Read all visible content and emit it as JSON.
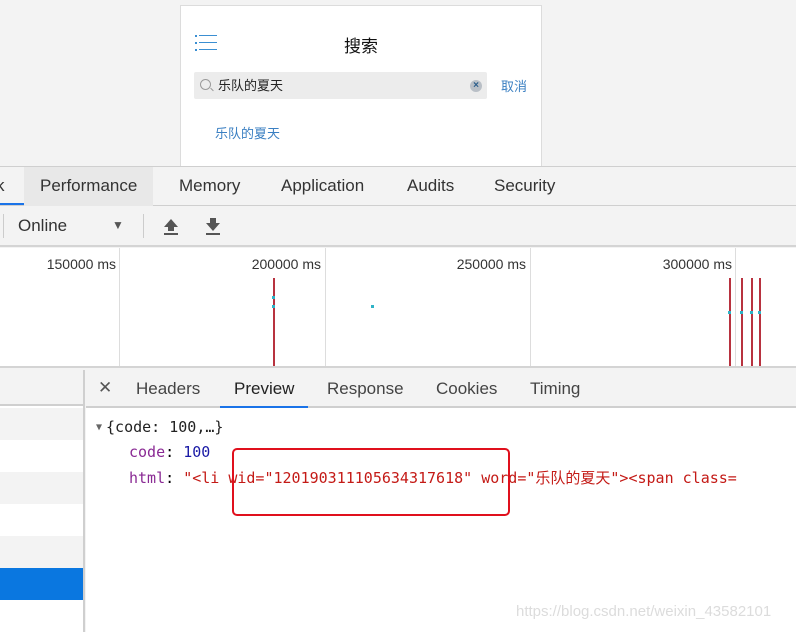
{
  "page": {
    "title": "搜索",
    "search": {
      "value": "乐队的夏天",
      "placeholder": ""
    },
    "cancel_label": "取消",
    "suggestion": "乐队的夏天"
  },
  "devtools": {
    "tabs": [
      {
        "label": "k"
      },
      {
        "label": "Performance",
        "active": true
      },
      {
        "label": "Memory"
      },
      {
        "label": "Application"
      },
      {
        "label": "Audits"
      },
      {
        "label": "Security"
      }
    ],
    "toolbar": {
      "throttle": "Online",
      "upload_icon": "import-icon",
      "download_icon": "export-icon"
    },
    "timeline": {
      "ticks": [
        "150000 ms",
        "200000 ms",
        "250000 ms",
        "300000 ms"
      ]
    },
    "detail": {
      "close_icon": "close-icon",
      "tabs": [
        {
          "label": "Headers"
        },
        {
          "label": "Preview",
          "active": true
        },
        {
          "label": "Response"
        },
        {
          "label": "Cookies"
        },
        {
          "label": "Timing"
        }
      ],
      "preview": {
        "root_summary": "{code: 100,…}",
        "code_key": "code",
        "code_value": "100",
        "html_key": "html",
        "html_prefix": "\"<li ",
        "html_wid": "wid=\"120190311105634317618\"",
        "html_rest": " word=\"乐队的夏天\"><span class="
      }
    }
  },
  "watermark": "https://blog.csdn.net/weixin_43582101"
}
